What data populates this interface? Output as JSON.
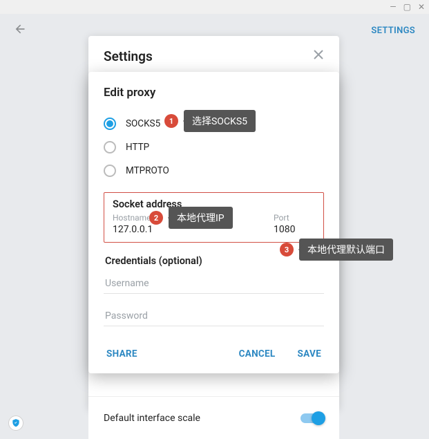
{
  "window": {
    "minimize": "—",
    "maximize": "▢",
    "close": "✕"
  },
  "topbar": {
    "settings_link": "SETTINGS"
  },
  "settings_panel": {
    "title": "Settings"
  },
  "dialog": {
    "title": "Edit proxy",
    "radios": {
      "socks5": "SOCKS5",
      "http": "HTTP",
      "mtproto": "MTPROTO"
    },
    "socket": {
      "title": "Socket address",
      "hostname_label": "Hostname",
      "hostname_value": "127.0.0.1",
      "port_label": "Port",
      "port_value": "1080"
    },
    "credentials": {
      "title": "Credentials (optional)",
      "username_placeholder": "Username",
      "password_placeholder": "Password"
    },
    "buttons": {
      "share": "SHARE",
      "cancel": "CANCEL",
      "save": "SAVE"
    }
  },
  "footer": {
    "default_scale": "Default interface scale"
  },
  "annotations": {
    "n1": "1",
    "t1": "选择SOCKS5",
    "n2": "2",
    "t2": "本地代理IP",
    "n3": "3",
    "t3": "本地代理默认端口"
  },
  "colors": {
    "accent": "#1e9fe4",
    "link": "#2d88c2",
    "highlight_border": "#d14f45",
    "badge": "#d84b3a"
  }
}
